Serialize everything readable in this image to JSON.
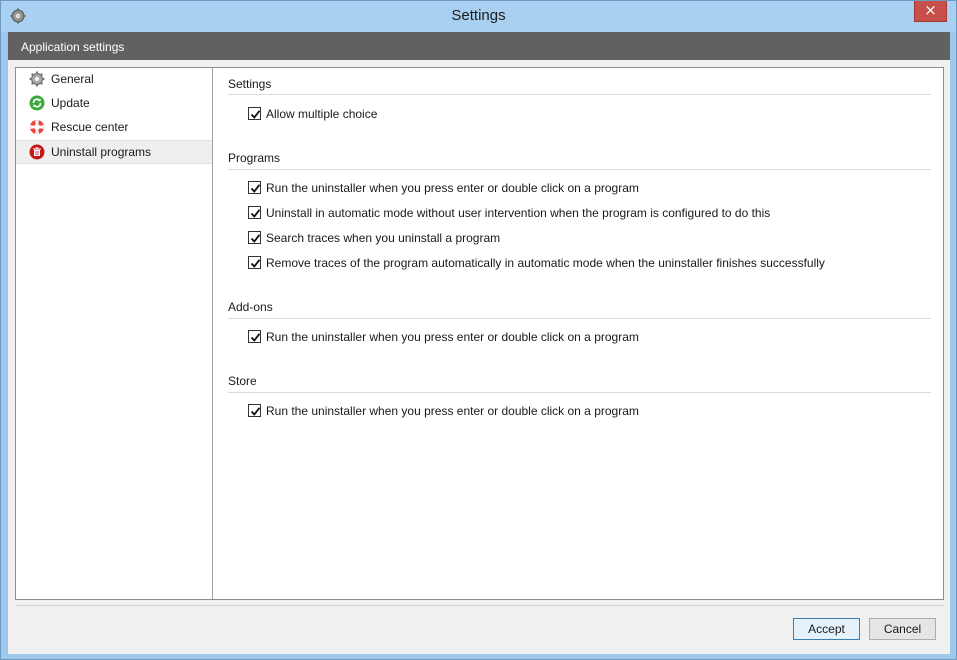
{
  "window": {
    "title": "Settings",
    "close_glyph": "×"
  },
  "header": {
    "title": "Application settings"
  },
  "sidebar": {
    "items": [
      {
        "label": "General",
        "icon": "gear-icon"
      },
      {
        "label": "Update",
        "icon": "refresh-icon"
      },
      {
        "label": "Rescue center",
        "icon": "lifebuoy-icon"
      },
      {
        "label": "Uninstall programs",
        "icon": "trash-icon",
        "selected": true
      }
    ]
  },
  "sections": [
    {
      "title": "Settings",
      "options": [
        {
          "label": "Allow multiple choice",
          "checked": true
        }
      ]
    },
    {
      "title": "Programs",
      "options": [
        {
          "label": "Run the uninstaller when you press enter or double click on a program",
          "checked": true
        },
        {
          "label": "Uninstall in automatic mode without user intervention when the program is configured to do this",
          "checked": true
        },
        {
          "label": "Search traces when you uninstall a program",
          "checked": true
        },
        {
          "label": "Remove traces of the program automatically in automatic mode when the uninstaller finishes successfully",
          "checked": true
        }
      ]
    },
    {
      "title": "Add-ons",
      "options": [
        {
          "label": "Run the uninstaller when you press enter or double click on a program",
          "checked": true
        }
      ]
    },
    {
      "title": "Store",
      "options": [
        {
          "label": "Run the uninstaller when you press enter or double click on a program",
          "checked": true
        }
      ]
    }
  ],
  "footer": {
    "accept_label": "Accept",
    "cancel_label": "Cancel"
  },
  "colors": {
    "accent": "#3c7fb1",
    "header_band": "#616161",
    "titlebar": "#a9d0f0",
    "close": "#c7504a"
  }
}
